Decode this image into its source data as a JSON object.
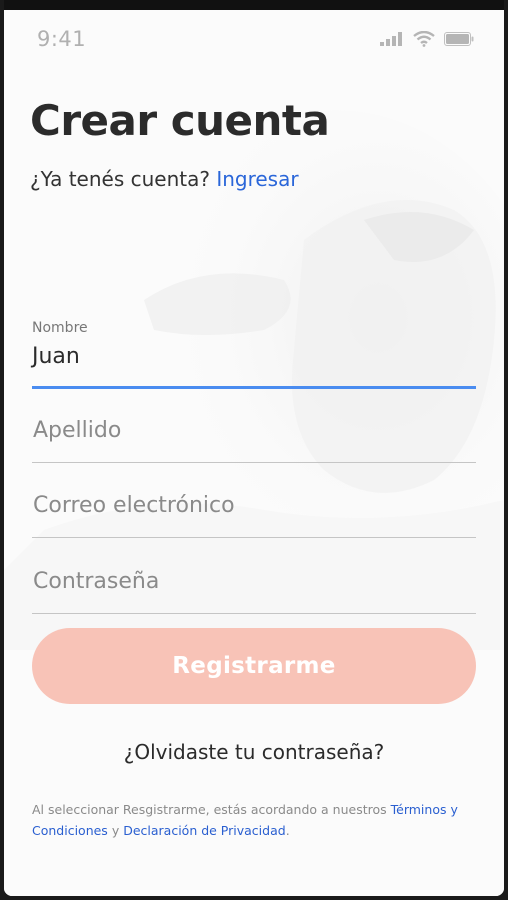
{
  "status_bar": {
    "time": "9:41",
    "icons": [
      "signal-icon",
      "wifi-icon",
      "battery-icon"
    ]
  },
  "header": {
    "title": "Crear cuenta",
    "subtitle_prefix": "¿Ya tenés cuenta?",
    "login_link": "Ingresar"
  },
  "form": {
    "nombre": {
      "label": "Nombre",
      "value": "Juan"
    },
    "apellido": {
      "placeholder": "Apellido",
      "value": ""
    },
    "correo": {
      "placeholder": "Correo electrónico",
      "value": ""
    },
    "contrasena": {
      "placeholder": "Contraseña",
      "value": ""
    }
  },
  "register_button": "Registrarme",
  "forgot_password": "¿Olvidaste tu contraseña?",
  "legal": {
    "text": "Al seleccionar Resgistrarme, estás acordando a nuestros",
    "terms_link": "Términos y Condiciones",
    "conjunction": "y",
    "privacy_link": "Declaración de Privacidad",
    "end": "."
  },
  "colors": {
    "accent": "#4a8cf0",
    "link": "#2a66d9",
    "button_bg": "#f8c3b7",
    "title": "#2b2b2b"
  }
}
